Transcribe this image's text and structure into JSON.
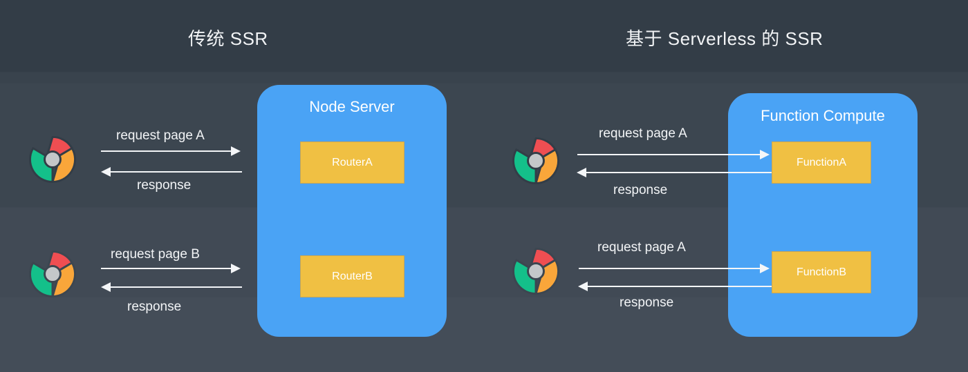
{
  "titles": {
    "left": "传统 SSR",
    "right": "基于 Serverless 的 SSR"
  },
  "panels": {
    "node": {
      "title": "Node Server",
      "boxes": [
        {
          "label": "RouterA"
        },
        {
          "label": "RouterB"
        }
      ]
    },
    "fc": {
      "title": "Function Compute",
      "boxes": [
        {
          "label": "FunctionA"
        },
        {
          "label": "FunctionB"
        }
      ]
    }
  },
  "flows": {
    "left": [
      {
        "request": "request  page A",
        "response": "response"
      },
      {
        "request": "request  page B",
        "response": "response"
      }
    ],
    "right": [
      {
        "request": "request  page A",
        "response": "response"
      },
      {
        "request": "request  page A",
        "response": "response"
      }
    ]
  },
  "icons": {
    "browser": "chrome-logo-icon"
  },
  "colors": {
    "background_top": "#333d47",
    "background_bottom": "#444d58",
    "panel_blue": "#4aa3f5",
    "box_orange": "#f0c043",
    "box_border": "#c9a552",
    "arrow_white": "#f4f6f8",
    "text_white": "#f2f4f6",
    "chrome_red": "#ef4e52",
    "chrome_green": "#14c08a",
    "chrome_yellow": "#f9a63a",
    "chrome_center": "#c4c7c9",
    "chrome_outline": "#333d47"
  }
}
